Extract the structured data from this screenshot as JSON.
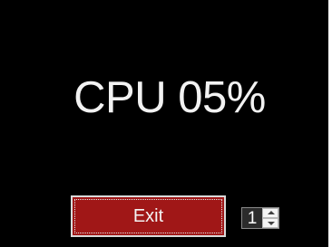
{
  "monitor": {
    "cpu_text": "CPU 05%",
    "cpu_percent": 5
  },
  "controls": {
    "exit_label": "Exit",
    "spinner_value": "1"
  },
  "colors": {
    "background": "#000000",
    "text": "#f2f2f2",
    "exit_button": "#a01717"
  },
  "icons": {
    "spin_up": "chevron-up-icon",
    "spin_down": "chevron-down-icon"
  }
}
